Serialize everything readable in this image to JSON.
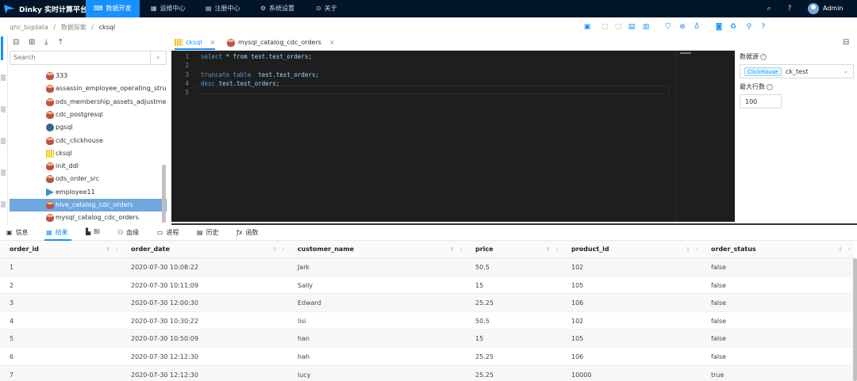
{
  "app": {
    "title": "Dinky 实时计算平台"
  },
  "nav": {
    "items": [
      {
        "label": "数据开发",
        "icon": "code-icon",
        "active": true
      },
      {
        "label": "运维中心",
        "icon": "table-icon",
        "active": false
      },
      {
        "label": "注册中心",
        "icon": "grid-icon",
        "active": false
      },
      {
        "label": "系统设置",
        "icon": "gear-icon",
        "active": false
      },
      {
        "label": "关于",
        "icon": "info-icon",
        "active": false
      }
    ],
    "user": "Admin"
  },
  "breadcrumb": {
    "items": [
      "qhc_bigdata",
      "数据探索",
      "cksql"
    ],
    "separator": "/"
  },
  "tree": {
    "search_placeholder": "Search",
    "items": [
      {
        "label": "333",
        "icon": "db"
      },
      {
        "label": "assassin_employee_operating_structure",
        "icon": "db"
      },
      {
        "label": "ods_membership_assets_adjustment_gr",
        "icon": "db"
      },
      {
        "label": "cdc_postgresql",
        "icon": "db"
      },
      {
        "label": "pgsql",
        "icon": "pg"
      },
      {
        "label": "cdc_clickhouse",
        "icon": "db"
      },
      {
        "label": "cksql",
        "icon": "ch"
      },
      {
        "label": "init_ddl",
        "icon": "db"
      },
      {
        "label": "ods_order_src",
        "icon": "db"
      },
      {
        "label": "employee11",
        "icon": "emp"
      },
      {
        "label": "hive_catalog_cdc_orders",
        "icon": "db",
        "selected": true
      },
      {
        "label": "mysql_catalog_cdc_orders",
        "icon": "db"
      }
    ]
  },
  "editor": {
    "tabs": [
      {
        "label": "cksql",
        "active": true,
        "close": "×"
      },
      {
        "label": "mysql_catalog_cdc_orders",
        "active": false,
        "close": "×"
      }
    ],
    "lines": [
      {
        "no": "1",
        "kw": "select",
        "rest": " * from test.test_orders;"
      },
      {
        "no": "2",
        "kw": "",
        "rest": ""
      },
      {
        "no": "3",
        "kw": "truncate table",
        "rest": "  test.test_orders;"
      },
      {
        "no": "4",
        "kw": "desc",
        "rest": " test.test_orders;"
      },
      {
        "no": "5",
        "kw": "",
        "rest": ""
      }
    ]
  },
  "right_panel": {
    "datasource_label": "数据源",
    "datasource_tag": "ClickHouse",
    "datasource_value": "ck_test",
    "maxrows_label": "最大行数",
    "maxrows_value": "100"
  },
  "bottom_tabs": [
    {
      "label": "信息",
      "icon": "terminal-icon"
    },
    {
      "label": "结果",
      "icon": "table-icon",
      "active": true
    },
    {
      "label": "BI",
      "icon": "bar-chart-icon"
    },
    {
      "label": "血缘",
      "icon": "lineage-icon"
    },
    {
      "label": "进程",
      "icon": "desktop-icon"
    },
    {
      "label": "历史",
      "icon": "calendar-icon"
    },
    {
      "label": "函数",
      "icon": "function-icon"
    }
  ],
  "results": {
    "columns": [
      "order_id",
      "order_date",
      "customer_name",
      "price",
      "product_id",
      "order_status"
    ],
    "rows": [
      [
        "1",
        "2020-07-30 10:08:22",
        "Jark",
        "50.5",
        "102",
        "false"
      ],
      [
        "2",
        "2020-07-30 10:11:09",
        "Sally",
        "15",
        "105",
        "false"
      ],
      [
        "3",
        "2020-07-30 12:00:30",
        "Edward",
        "25.25",
        "106",
        "false"
      ],
      [
        "4",
        "2020-07-30 10:30:22",
        "lisi",
        "50.5",
        "102",
        "false"
      ],
      [
        "5",
        "2020-07-30 10:50:09",
        "han",
        "15",
        "105",
        "false"
      ],
      [
        "6",
        "2020-07-30 12:12:30",
        "hah",
        "25.25",
        "106",
        "false"
      ],
      [
        "7",
        "2020-07-30 12:12:30",
        "lucy",
        "25.25",
        "10000",
        "true"
      ]
    ]
  },
  "colors": {
    "accent": "#1890ff",
    "nav_bg": "#001529",
    "editor_bg": "#1e1e1e",
    "selected_row": "#6ea8de"
  }
}
